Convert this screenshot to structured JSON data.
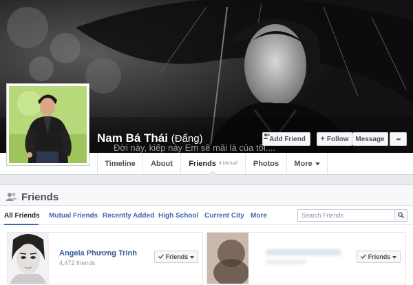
{
  "profile": {
    "name": "Nam Bá Thái",
    "alternate_name": "(Đẩng)",
    "cover_quote": "Đời này, kiếp này Em sẽ mãi là của tôi...."
  },
  "cover_actions": {
    "add_friend": "Add Friend",
    "follow": "Follow",
    "message": "Message",
    "more": "•••"
  },
  "nav": {
    "timeline": "Timeline",
    "about": "About",
    "friends": "Friends",
    "friends_sub": "4 Mutual",
    "photos": "Photos",
    "more": "More"
  },
  "friends_section": {
    "title": "Friends",
    "filters": [
      "All Friends",
      "Mutual Friends",
      "Recently Added",
      "High School",
      "Current City",
      "More"
    ],
    "active_filter": "All Friends",
    "search_placeholder": "Search Friends"
  },
  "friend_cards": [
    {
      "name": "Angela Phương Trinh",
      "count": "4,472 friends",
      "button": "Friends"
    },
    {
      "name": "",
      "count": "",
      "button": "Friends"
    }
  ],
  "icons": {
    "add_friend": "person-plus-icon",
    "follow": "plus-icon",
    "friends_header": "people-icon",
    "search": "magnifier-icon",
    "check": "check-icon",
    "caret": "caret-down-icon"
  },
  "colors": {
    "link_blue": "#365899",
    "filter_blue": "#4267b2",
    "page_bg": "#e9ebee"
  }
}
